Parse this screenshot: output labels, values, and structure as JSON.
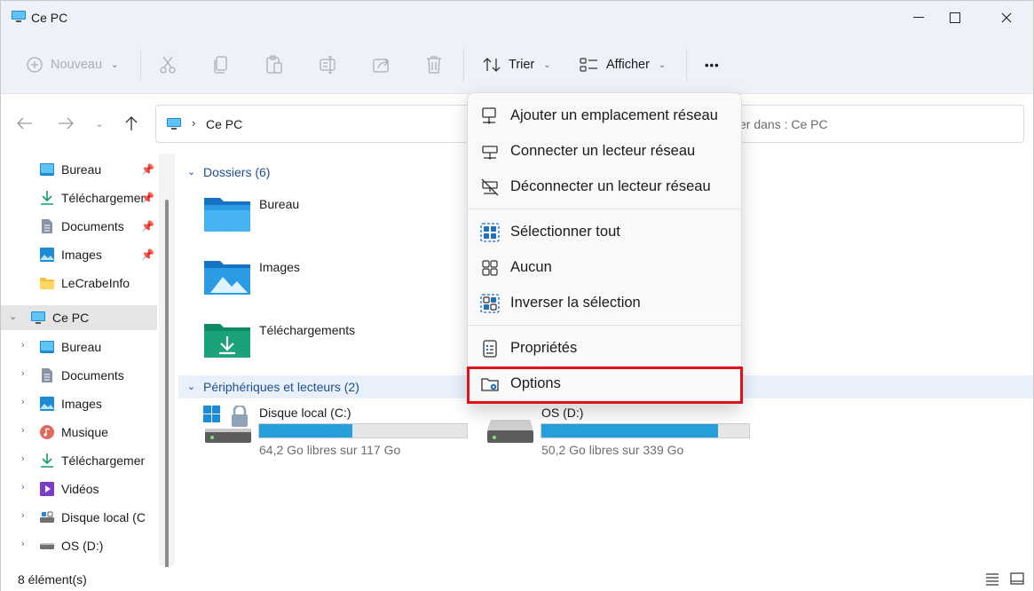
{
  "window": {
    "title": "Ce PC"
  },
  "toolbar": {
    "new_label": "Nouveau",
    "sort_label": "Trier",
    "view_label": "Afficher",
    "more_label": "•••"
  },
  "address": {
    "location": "Ce PC",
    "search_placeholder": "er dans : Ce PC"
  },
  "sidebar": {
    "quick_access": [
      {
        "label": "Bureau",
        "icon": "desktop-icon"
      },
      {
        "label": "Téléchargements",
        "icon": "download-icon"
      },
      {
        "label": "Documents",
        "icon": "document-icon"
      },
      {
        "label": "Images",
        "icon": "image-icon"
      },
      {
        "label": "LeCrabeInfo",
        "icon": "folder-icon"
      }
    ],
    "this_pc": {
      "label": "Ce PC",
      "icon": "computer-icon"
    },
    "this_pc_children": [
      {
        "label": "Bureau",
        "icon": "desktop-icon"
      },
      {
        "label": "Documents",
        "icon": "document-icon"
      },
      {
        "label": "Images",
        "icon": "image-icon"
      },
      {
        "label": "Musique",
        "icon": "music-icon"
      },
      {
        "label": "Téléchargements",
        "icon": "download-icon"
      },
      {
        "label": "Vidéos",
        "icon": "video-icon"
      },
      {
        "label": "Disque local (C:)",
        "icon": "drive-icon"
      },
      {
        "label": "OS (D:)",
        "icon": "drive-icon"
      }
    ]
  },
  "main": {
    "folders_header": "Dossiers (6)",
    "folders": [
      {
        "label": "Bureau"
      },
      {
        "label": "Images"
      },
      {
        "label": "Téléchargements"
      }
    ],
    "devices_header": "Périphériques et lecteurs (2)",
    "drives": [
      {
        "label": "Disque local (C:)",
        "free": "64,2 Go libres sur 117 Go",
        "used_fraction": 0.45
      },
      {
        "label": "OS (D:)",
        "free": "50,2 Go libres sur 339 Go",
        "used_fraction": 0.85
      }
    ]
  },
  "menu": {
    "items": [
      {
        "label": "Ajouter un emplacement réseau",
        "icon": "network-add-icon"
      },
      {
        "label": "Connecter un lecteur réseau",
        "icon": "network-drive-icon"
      },
      {
        "label": "Déconnecter un lecteur réseau",
        "icon": "network-disconnect-icon"
      },
      {
        "label": "Sélectionner tout",
        "icon": "select-all-icon"
      },
      {
        "label": "Aucun",
        "icon": "select-none-icon"
      },
      {
        "label": "Inverser la sélection",
        "icon": "invert-selection-icon"
      },
      {
        "label": "Propriétés",
        "icon": "properties-icon"
      },
      {
        "label": "Options",
        "icon": "folder-options-icon"
      }
    ]
  },
  "status": {
    "items_count": "8 élément(s)"
  },
  "colors": {
    "accent": "#26a0da",
    "highlight": "#e0111b",
    "folder_blue": "#1a8ad6",
    "folder_green": "#1aa37a"
  }
}
